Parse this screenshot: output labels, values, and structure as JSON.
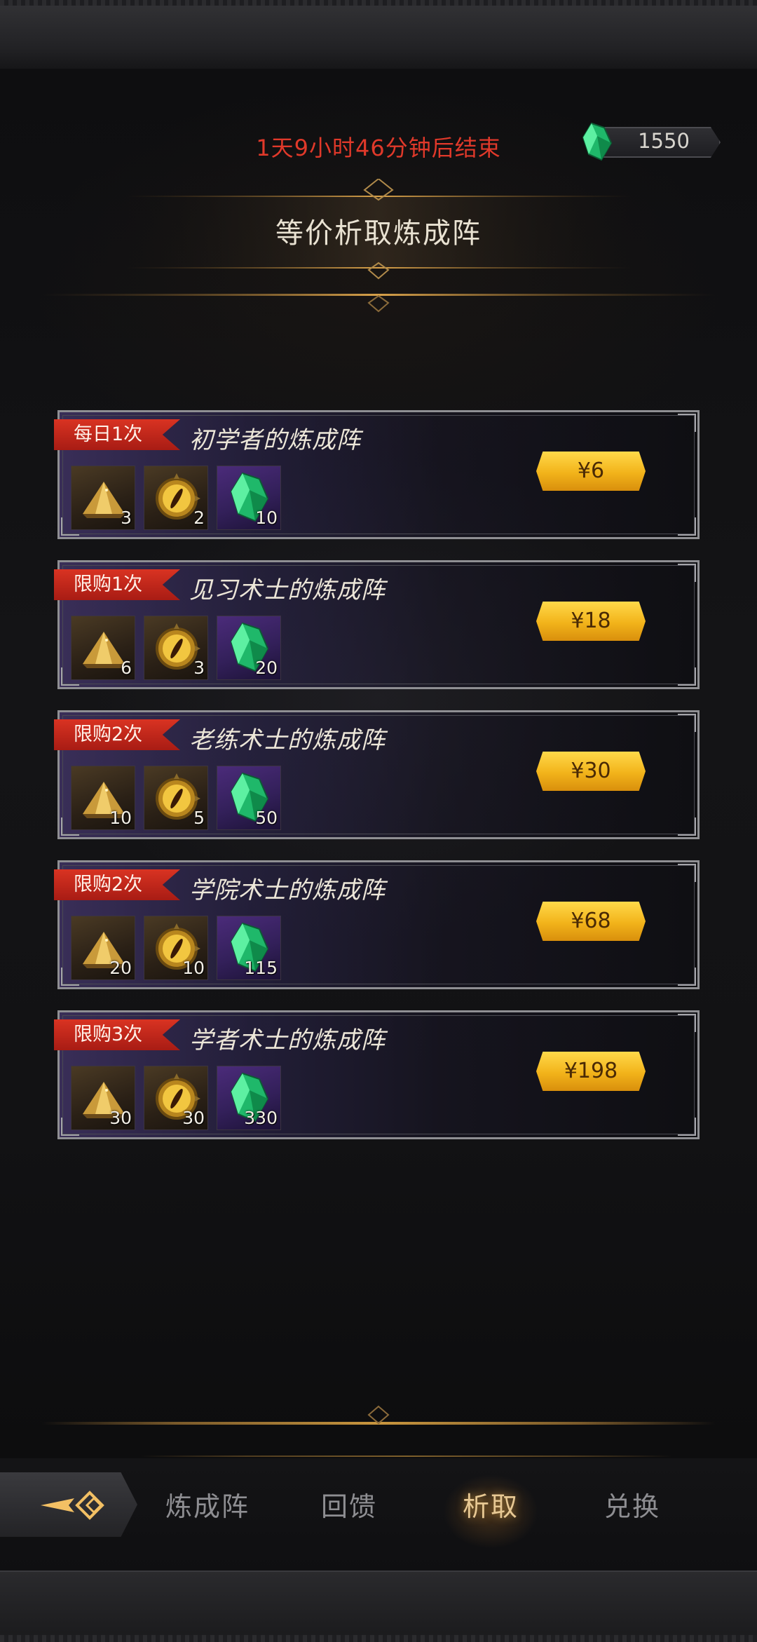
{
  "event": {
    "countdown": "1天9小时46分钟后结束",
    "title": "等价析取炼成阵"
  },
  "currency": {
    "icon": "green-crystal-icon",
    "amount": "1550"
  },
  "packages": [
    {
      "limit": "每日1次",
      "name": "初学者的炼成阵",
      "price": "¥6",
      "items": [
        {
          "icon": "gold-ore-icon",
          "qty": "3"
        },
        {
          "icon": "golden-eye-icon",
          "qty": "2"
        },
        {
          "icon": "green-crystal-icon",
          "qty": "10"
        }
      ]
    },
    {
      "limit": "限购1次",
      "name": "见习术士的炼成阵",
      "price": "¥18",
      "items": [
        {
          "icon": "gold-ore-icon",
          "qty": "6"
        },
        {
          "icon": "golden-eye-icon",
          "qty": "3"
        },
        {
          "icon": "green-crystal-icon",
          "qty": "20"
        }
      ]
    },
    {
      "limit": "限购2次",
      "name": "老练术士的炼成阵",
      "price": "¥30",
      "items": [
        {
          "icon": "gold-ore-icon",
          "qty": "10"
        },
        {
          "icon": "golden-eye-icon",
          "qty": "5"
        },
        {
          "icon": "green-crystal-icon",
          "qty": "50"
        }
      ]
    },
    {
      "limit": "限购2次",
      "name": "学院术士的炼成阵",
      "price": "¥68",
      "items": [
        {
          "icon": "gold-ore-icon",
          "qty": "20"
        },
        {
          "icon": "golden-eye-icon",
          "qty": "10"
        },
        {
          "icon": "green-crystal-icon",
          "qty": "115"
        }
      ]
    },
    {
      "limit": "限购3次",
      "name": "学者术士的炼成阵",
      "price": "¥198",
      "items": [
        {
          "icon": "gold-ore-icon",
          "qty": "30"
        },
        {
          "icon": "golden-eye-icon",
          "qty": "30"
        },
        {
          "icon": "green-crystal-icon",
          "qty": "330"
        }
      ]
    }
  ],
  "tabs": {
    "home_icon": "diamond-arrow-icon",
    "items": [
      {
        "label": "炼成阵"
      },
      {
        "label": "回馈"
      },
      {
        "label": "析取",
        "active": true
      },
      {
        "label": "兑换"
      }
    ]
  },
  "colors": {
    "accent_red": "#e0392a",
    "price_gold": "#f2b31a",
    "active_tab": "#e7c893"
  }
}
